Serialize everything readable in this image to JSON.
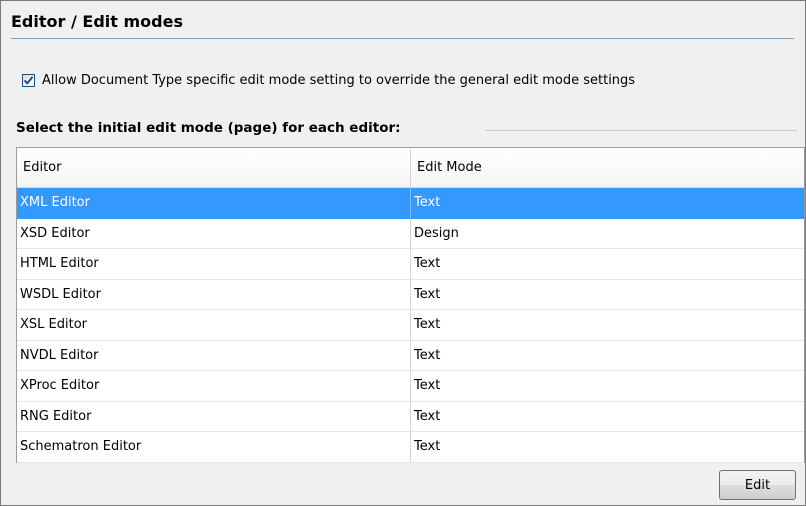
{
  "header": {
    "title": "Editor / Edit modes"
  },
  "override_checkbox": {
    "checked": true,
    "label": "Allow Document Type specific edit mode setting to override the general edit mode settings"
  },
  "section": {
    "title": "Select the initial edit mode (page) for each editor:"
  },
  "table": {
    "columns": [
      "Editor",
      "Edit Mode"
    ],
    "selected_row": 0,
    "rows": [
      {
        "editor": "XML Editor",
        "mode": "Text"
      },
      {
        "editor": "XSD Editor",
        "mode": "Design"
      },
      {
        "editor": "HTML Editor",
        "mode": "Text"
      },
      {
        "editor": "WSDL Editor",
        "mode": "Text"
      },
      {
        "editor": "XSL Editor",
        "mode": "Text"
      },
      {
        "editor": "NVDL Editor",
        "mode": "Text"
      },
      {
        "editor": "XProc Editor",
        "mode": "Text"
      },
      {
        "editor": "RNG Editor",
        "mode": "Text"
      },
      {
        "editor": "Schematron Editor",
        "mode": "Text"
      }
    ]
  },
  "buttons": {
    "edit_label": "Edit"
  },
  "colors": {
    "selection": "#3399ff",
    "title_rule": "#7f9db9",
    "panel_background": "#f0f0f0"
  }
}
